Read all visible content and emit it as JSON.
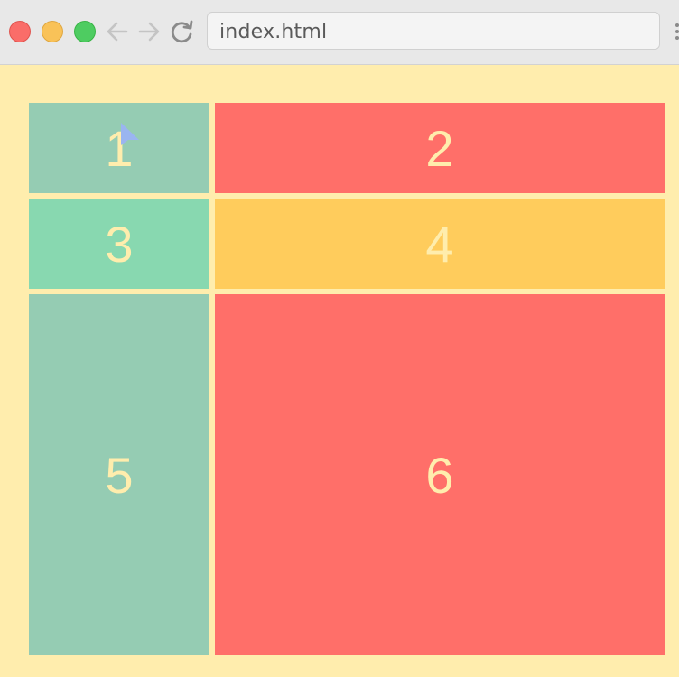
{
  "browser": {
    "address": "index.html",
    "icons": [
      "close-icon",
      "minimize-icon",
      "maximize-icon",
      "back-arrow-icon",
      "forward-arrow-icon",
      "reload-icon",
      "menu-icon"
    ],
    "traffic_colors": {
      "close": "#fc605c",
      "minimize": "#fdbc40",
      "maximize": "#34c84a"
    }
  },
  "page": {
    "background": "#ffedad",
    "text_color": "#ffedad",
    "items": [
      {
        "label": "1",
        "color": "#95ccb3"
      },
      {
        "label": "2",
        "color": "#ff6f69"
      },
      {
        "label": "3",
        "color": "#88d8b0"
      },
      {
        "label": "4",
        "color": "#ffcc5c"
      },
      {
        "label": "5",
        "color": "#95ccb3"
      },
      {
        "label": "6",
        "color": "#ff6f69"
      }
    ]
  }
}
